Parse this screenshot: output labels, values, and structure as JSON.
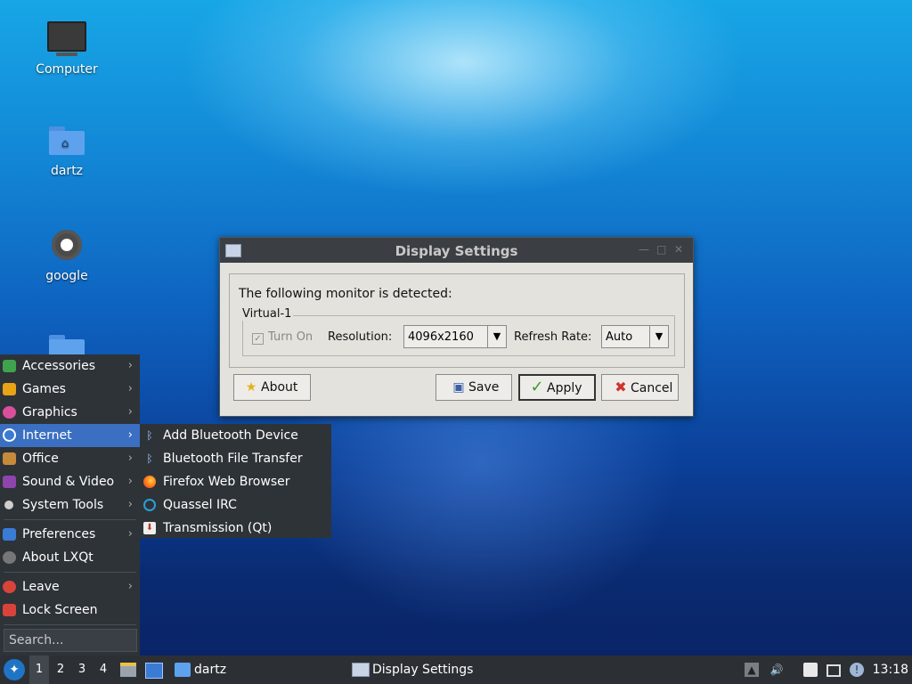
{
  "desktop": {
    "icons": [
      {
        "label": "Computer",
        "icon": "computer-icon"
      },
      {
        "label": "dartz",
        "icon": "home-folder-icon"
      },
      {
        "label": "google",
        "icon": "gear-icon"
      }
    ]
  },
  "dialog": {
    "title": "Display Settings",
    "detected_text": "The following monitor is detected:",
    "monitor_name": "Virtual-1",
    "turn_on_label": "Turn On",
    "turn_on_checked": true,
    "resolution_label": "Resolution:",
    "resolution_value": "4096x2160",
    "refresh_label": "Refresh Rate:",
    "refresh_value": "Auto",
    "buttons": {
      "about": "About",
      "save": "Save",
      "apply": "Apply",
      "cancel": "Cancel"
    }
  },
  "menu": {
    "items": [
      {
        "label": "Accessories",
        "icon": "accessories-icon",
        "color": "#3fa34d"
      },
      {
        "label": "Games",
        "icon": "games-icon",
        "color": "#e8a317"
      },
      {
        "label": "Graphics",
        "icon": "graphics-icon",
        "color": "#d94f9b"
      },
      {
        "label": "Internet",
        "icon": "internet-icon",
        "color": "#3a7bd5"
      },
      {
        "label": "Office",
        "icon": "office-icon",
        "color": "#c78a3b"
      },
      {
        "label": "Sound & Video",
        "icon": "sound-video-icon",
        "color": "#8e44ad"
      },
      {
        "label": "System Tools",
        "icon": "system-tools-icon",
        "color": "#cfcfcf"
      },
      {
        "label": "Preferences",
        "icon": "preferences-icon",
        "color": "#3a7bd5"
      },
      {
        "label": "About LXQt",
        "icon": "info-icon",
        "color": "#777777"
      },
      {
        "label": "Leave",
        "icon": "power-icon",
        "color": "#d9443a"
      },
      {
        "label": "Lock Screen",
        "icon": "lock-icon",
        "color": "#d9443a"
      }
    ],
    "search_placeholder": "Search..."
  },
  "submenu": {
    "items": [
      {
        "label": "Add Bluetooth Device",
        "icon": "bluetooth-icon"
      },
      {
        "label": "Bluetooth File Transfer",
        "icon": "bluetooth-icon"
      },
      {
        "label": "Firefox Web Browser",
        "icon": "firefox-icon"
      },
      {
        "label": "Quassel IRC",
        "icon": "quassel-icon"
      },
      {
        "label": "Transmission (Qt)",
        "icon": "transmission-icon"
      }
    ]
  },
  "taskbar": {
    "workspaces": [
      "1",
      "2",
      "3",
      "4"
    ],
    "active_workspace": "1",
    "folder_task": "dartz",
    "window_task": "Display Settings",
    "clock": "13:18"
  }
}
